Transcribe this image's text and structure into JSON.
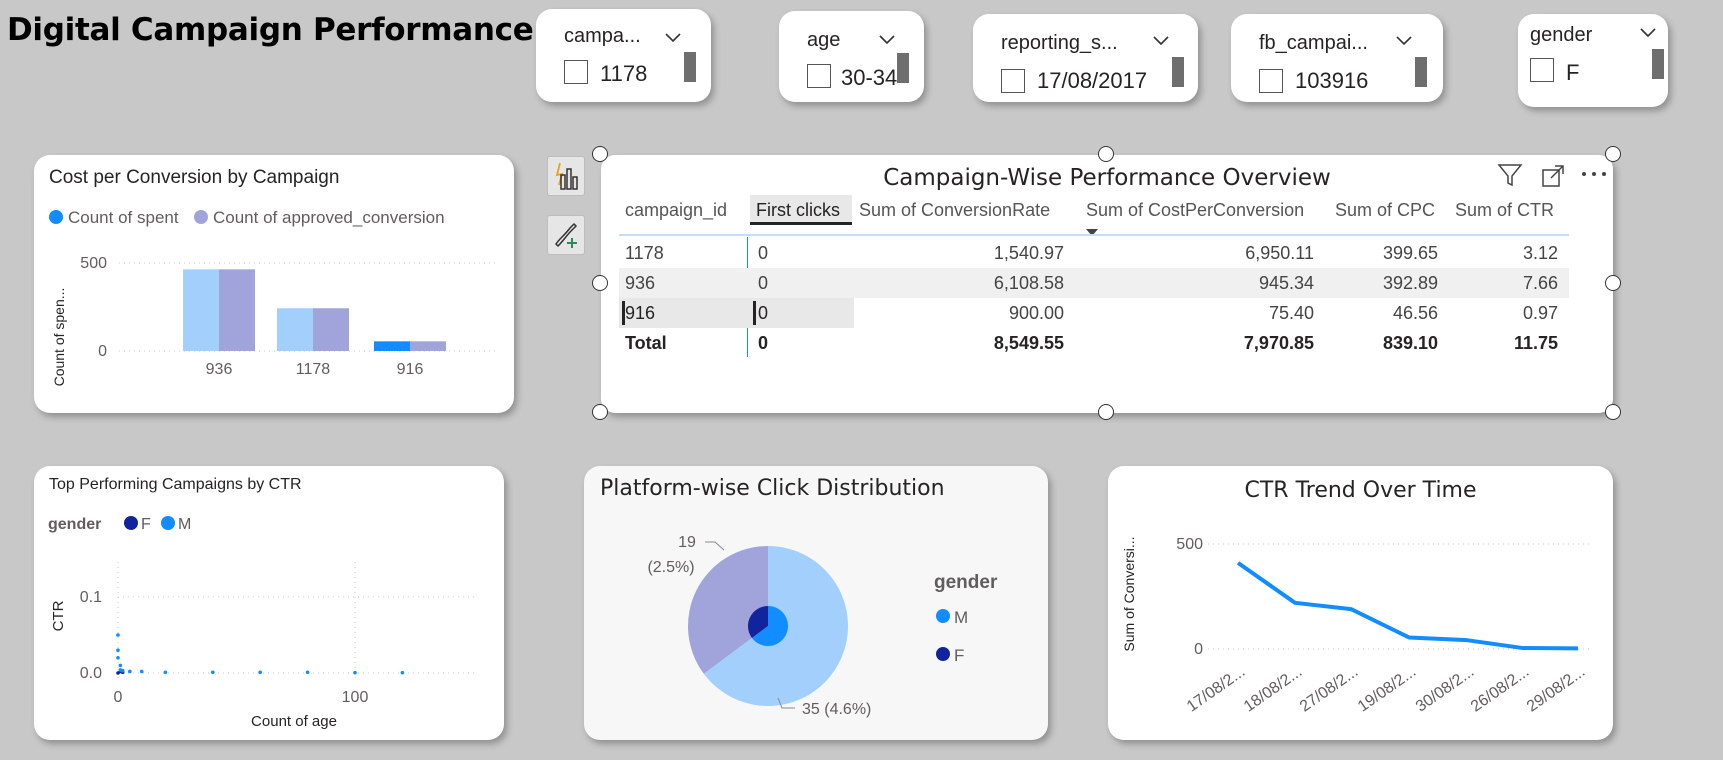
{
  "page": {
    "title": "Digital Campaign Performance"
  },
  "slicers": [
    {
      "title": "campa...",
      "value": "1178"
    },
    {
      "title": "age",
      "value": "30-34"
    },
    {
      "title": "reporting_s...",
      "value": "17/08/2017"
    },
    {
      "title": "fb_campai...",
      "value": "103916"
    },
    {
      "title": "gender",
      "value": "F"
    }
  ],
  "cost_chart": {
    "title": "Cost per Conversion by Campaign",
    "legend": [
      "Count of spent",
      "Count of approved_conversion"
    ],
    "ylabel": "Count of spen...",
    "yticks": [
      "500",
      "0"
    ],
    "colors": {
      "spent": "#118dff",
      "approved": "#a0a4da",
      "spent_faded": "#a3cffd"
    },
    "chart_data": {
      "type": "bar",
      "categories": [
        "936",
        "1178",
        "916"
      ],
      "series": [
        {
          "name": "Count of spent",
          "values": [
            464,
            243,
            55
          ]
        },
        {
          "name": "Count of approved_conversion",
          "values": [
            464,
            243,
            55
          ]
        }
      ],
      "ylabel": "Count of spen...",
      "ylim": [
        0,
        600
      ],
      "highlight_category": "916"
    }
  },
  "table_visual": {
    "title": "Campaign-Wise Performance Overview",
    "columns": [
      "campaign_id",
      "First clicks",
      "Sum of ConversionRate",
      "Sum of CostPerConversion",
      "Sum of CPC",
      "Sum of CTR"
    ],
    "rows": [
      [
        "1178",
        "0",
        "1,540.97",
        "6,950.11",
        "399.65",
        "3.12"
      ],
      [
        "936",
        "0",
        "6,108.58",
        "945.34",
        "392.89",
        "7.66"
      ],
      [
        "916",
        "0",
        "900.00",
        "75.40",
        "46.56",
        "0.97"
      ]
    ],
    "total": [
      "Total",
      "0",
      "8,549.55",
      "7,970.85",
      "839.10",
      "11.75"
    ],
    "sort_column": "Sum of CostPerConversion",
    "sort_direction": "descending",
    "toolbar_icons": [
      "filter-icon",
      "focus-mode-icon",
      "more-options-icon"
    ]
  },
  "side_buttons": [
    "build-visual-icon",
    "format-visual-icon"
  ],
  "ctr_scatter": {
    "title": "Top Performing Campaigns by CTR",
    "legend_title": "gender",
    "legend": [
      "F",
      "M"
    ],
    "colors": {
      "F": "#12239e",
      "M": "#118dff"
    },
    "xlabel": "Count of age",
    "ylabel": "CTR",
    "xticks": [
      "0",
      "100"
    ],
    "yticks": [
      "0.1",
      "0.0"
    ],
    "chart_data": {
      "type": "scatter",
      "xlabel": "Count of age",
      "ylabel": "CTR",
      "xlim": [
        0,
        150
      ],
      "ylim": [
        0,
        0.14
      ],
      "series": [
        {
          "name": "F",
          "points": [
            [
              0,
              0.0
            ],
            [
              1,
              0.002
            ],
            [
              2,
              0.001
            ]
          ]
        },
        {
          "name": "M",
          "points": [
            [
              0,
              0.05
            ],
            [
              0,
              0.03
            ],
            [
              0,
              0.02
            ],
            [
              1,
              0.01
            ],
            [
              1,
              0.004
            ],
            [
              2,
              0.003
            ],
            [
              5,
              0.002
            ],
            [
              10,
              0.002
            ],
            [
              20,
              0.001
            ],
            [
              40,
              0.001
            ],
            [
              60,
              0.001
            ],
            [
              80,
              0.001
            ],
            [
              100,
              0.0005
            ],
            [
              120,
              0.0005
            ]
          ]
        }
      ]
    }
  },
  "pie_chart": {
    "title": "Platform-wise Click Distribution",
    "legend_title": "gender",
    "legend": [
      "M",
      "F"
    ],
    "labels": [
      "19",
      "(2.5%)",
      "35 (4.6%)"
    ],
    "colors": {
      "M": "#118dff",
      "F": "#12239e",
      "M_faded": "#a3cffd",
      "F_faded": "#a0a4da"
    },
    "chart_data": {
      "type": "pie",
      "slices": [
        {
          "name": "M",
          "value": 35,
          "percent": 4.6
        },
        {
          "name": "F",
          "value": 19,
          "percent": 2.5
        }
      ]
    }
  },
  "line_chart": {
    "title": "CTR Trend Over Time",
    "ylabel": "Sum of Conversi...",
    "yticks": [
      "500",
      "0"
    ],
    "colors": {
      "line": "#118dff"
    },
    "chart_data": {
      "type": "line",
      "categories": [
        "17/08/2...",
        "18/08/2...",
        "27/08/2...",
        "19/08/2...",
        "30/08/2...",
        "26/08/2...",
        "29/08/2..."
      ],
      "values": [
        410,
        220,
        190,
        55,
        42,
        5,
        3
      ],
      "ylabel": "Sum of Conversi...",
      "ylim": [
        0,
        560
      ]
    }
  }
}
